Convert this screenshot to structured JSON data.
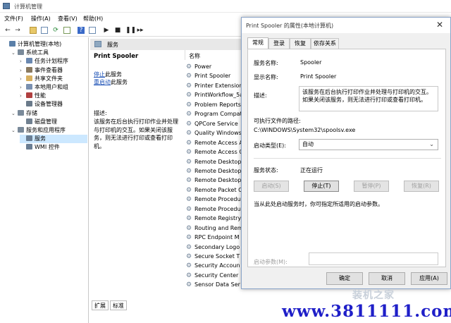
{
  "main_window": {
    "title": "计算机管理",
    "menu": [
      "文件(F)",
      "操作(A)",
      "查看(V)",
      "帮助(H)"
    ],
    "toolbar_icons": [
      "back-icon",
      "forward-icon",
      "folder-icon",
      "console-tree-icon",
      "refresh-icon",
      "export-icon",
      "help-icon",
      "properties-icon",
      "play-icon",
      "stop-icon",
      "pause-icon",
      "restart-icon"
    ]
  },
  "tree": [
    {
      "label": "计算机管理(本地)",
      "level": 0,
      "arrow": "",
      "color": "#5a7fa8"
    },
    {
      "label": "系统工具",
      "level": 1,
      "arrow": "⌄",
      "color": "#7a8a9a"
    },
    {
      "label": "任务计划程序",
      "level": 2,
      "arrow": "›",
      "color": "#6a88b0"
    },
    {
      "label": "事件查看器",
      "level": 2,
      "arrow": "›",
      "color": "#8a7a60"
    },
    {
      "label": "共享文件夹",
      "level": 2,
      "arrow": "›",
      "color": "#d8b060"
    },
    {
      "label": "本地用户和组",
      "level": 2,
      "arrow": "›",
      "color": "#7a90b0"
    },
    {
      "label": "性能",
      "level": 2,
      "arrow": "›",
      "color": "#b04040"
    },
    {
      "label": "设备管理器",
      "level": 2,
      "arrow": "",
      "color": "#6a7a8a"
    },
    {
      "label": "存储",
      "level": 1,
      "arrow": "⌄",
      "color": "#7a8a9a"
    },
    {
      "label": "磁盘管理",
      "level": 2,
      "arrow": "",
      "color": "#708090"
    },
    {
      "label": "服务和应用程序",
      "level": 1,
      "arrow": "⌄",
      "color": "#7a8a9a"
    },
    {
      "label": "服务",
      "level": 2,
      "arrow": "",
      "color": "#6a7e94",
      "selected": true
    },
    {
      "label": "WMI 控件",
      "level": 2,
      "arrow": "",
      "color": "#6a7e94"
    }
  ],
  "services_panel": {
    "header": "服务",
    "selected_name": "Print Spooler",
    "stop_link": [
      "停止",
      "此服务"
    ],
    "restart_link": [
      "重启动",
      "此服务"
    ],
    "desc_label": "描述:",
    "desc_text": "该服务在后台执行打印作业并处理与打印机的交互。如果关闭该服务，则无法进行打印或查看打印机。",
    "column_header": "名称",
    "services": [
      "Power",
      "Print Spooler",
      "Printer Extension",
      "PrintWorkflow_5a",
      "Problem Reports",
      "Program Compat",
      "QPCore Service",
      "Quality Windows",
      "Remote Access A",
      "Remote Access C",
      "Remote Desktop",
      "Remote Desktop",
      "Remote Desktop",
      "Remote Packet C",
      "Remote Procedu",
      "Remote Procedu",
      "Remote Registry",
      "Routing and Rem",
      "RPC Endpoint M",
      "Secondary Logo",
      "Secure Socket T",
      "Security Accoun",
      "Security Center",
      "Sensor Data Ser"
    ],
    "tabs": [
      "扩展",
      "标准"
    ]
  },
  "dialog": {
    "title": "Print Spooler 的属性(本地计算机)",
    "close_glyph": "✕",
    "tabs": [
      "常规",
      "登录",
      "恢复",
      "依存关系"
    ],
    "service_name_label": "服务名称:",
    "service_name": "Spooler",
    "display_name_label": "显示名称:",
    "display_name": "Print Spooler",
    "desc_label": "描述:",
    "desc_text": "该服务在后台执行打印作业并处理与打印机的交互。如果关闭该服务，则无法进行打印或查看打印机。",
    "exe_path_label": "可执行文件的路径:",
    "exe_path": "C:\\WINDOWS\\System32\\spoolsv.exe",
    "startup_type_label": "启动类型(E):",
    "startup_type": "自动",
    "status_label": "服务状态:",
    "status": "正在运行",
    "btn_start": "启动(S)",
    "btn_stop": "停止(T)",
    "btn_pause": "暂停(P)",
    "btn_resume": "恢复(R)",
    "hint": "当从此处启动服务时，你可指定所适用的启动参数。",
    "params_label": "启动参数(M):",
    "params_value": "",
    "btn_ok": "确定",
    "btn_cancel": "取消",
    "btn_apply": "应用(A)"
  },
  "watermark": {
    "url": "www.3811111.com",
    "logo": "装机之家"
  }
}
